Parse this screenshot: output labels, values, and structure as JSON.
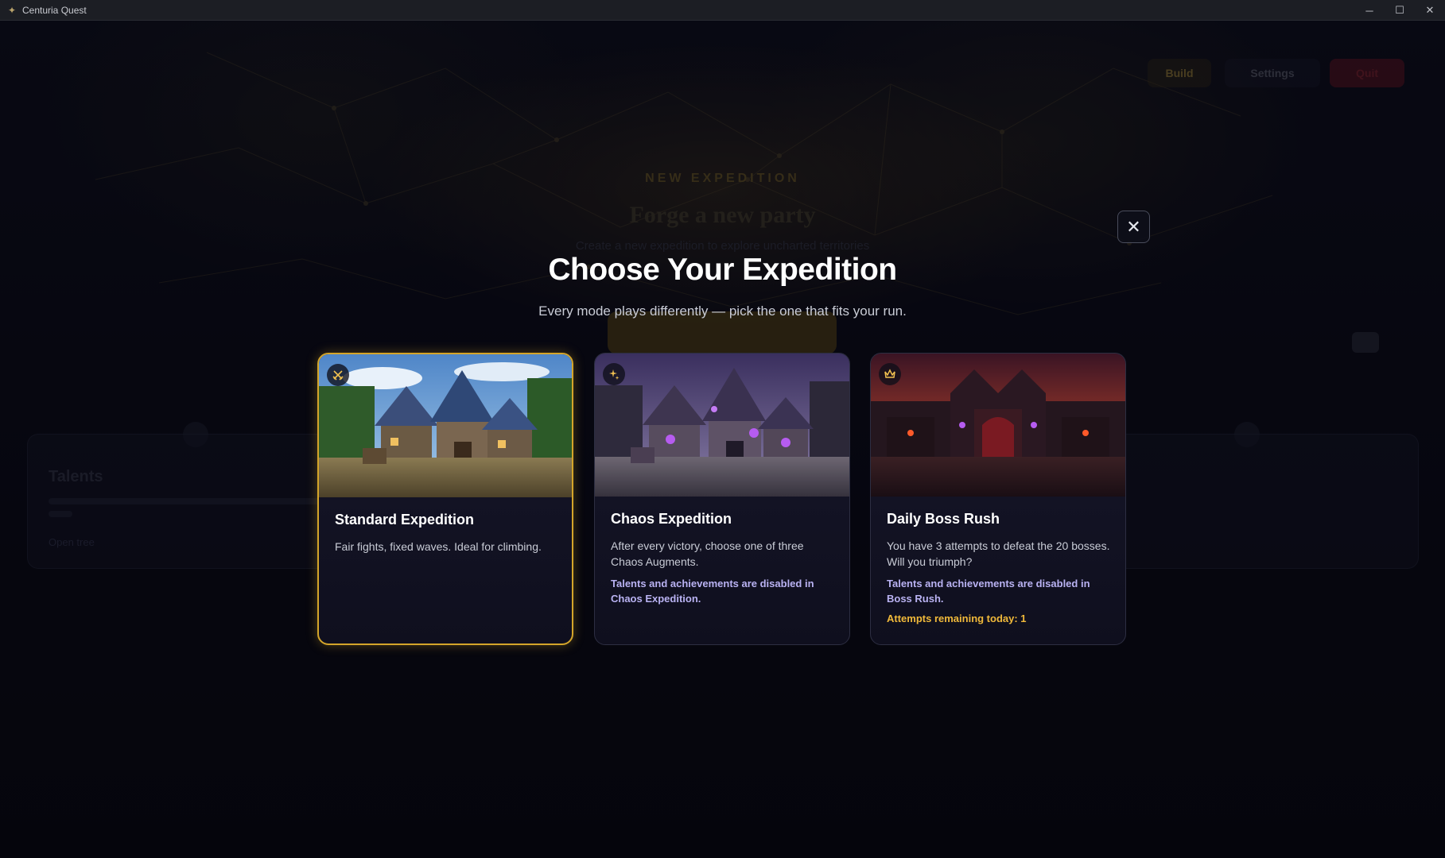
{
  "window": {
    "title": "Centuria Quest",
    "controls": {
      "minimize": "─",
      "maximize": "☐",
      "close": "✕"
    }
  },
  "background": {
    "top_buttons": [
      "Build",
      "Settings",
      "Quit"
    ],
    "eyebrow": "NEW EXPEDITION",
    "heading": "Forge a new party",
    "subtitle": "Create a new expedition to explore uncharted territories",
    "panel_left_title": "Talents",
    "panel_left_link": "Open tree"
  },
  "modal": {
    "title": "Choose Your Expedition",
    "subtitle": "Every mode plays differently — pick the one that fits your run.",
    "close_label": "✕"
  },
  "modes": [
    {
      "title": "Standard Expedition",
      "description": "Fair fights, fixed waves. Ideal for climbing.",
      "icon": "crossed-swords-icon",
      "selected": true,
      "theme": "village-day"
    },
    {
      "title": "Chaos Expedition",
      "description": "After every victory, choose one of three Chaos Augments.",
      "warning": "Talents and achievements are disabled in Chaos Expedition.",
      "icon": "sparkles-icon",
      "selected": false,
      "theme": "village-chaos"
    },
    {
      "title": "Daily Boss Rush",
      "description": "You have 3 attempts to defeat the 20 bosses. Will you triumph?",
      "warning": "Talents and achievements are disabled in Boss Rush.",
      "attempts": "Attempts remaining today: 1",
      "icon": "crown-icon",
      "selected": false,
      "theme": "castle-inferno"
    }
  ],
  "colors": {
    "accent_gold": "#d4a52a",
    "warning_purple": "#b9b2f2",
    "attempts_amber": "#f0b93a",
    "quit_red": "#6b1e28"
  }
}
